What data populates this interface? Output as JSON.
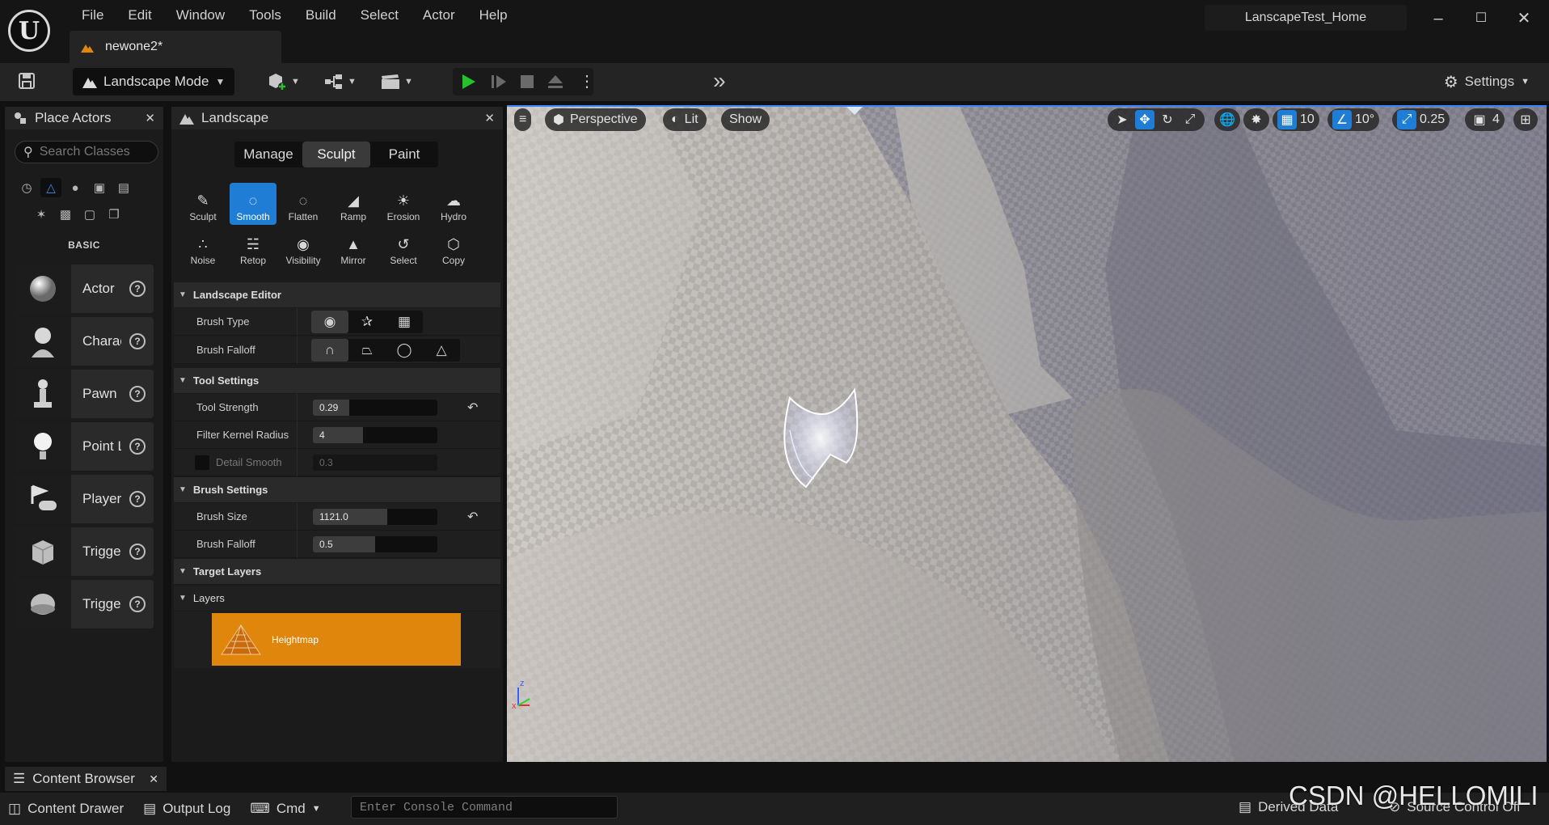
{
  "menu": [
    "File",
    "Edit",
    "Window",
    "Tools",
    "Build",
    "Select",
    "Actor",
    "Help"
  ],
  "document_tab": "newone2*",
  "project_name": "LanscapeTest_Home",
  "toolbar": {
    "mode": "Landscape Mode",
    "settings": "Settings"
  },
  "place_actors": {
    "title": "Place Actors",
    "search_placeholder": "Search Classes",
    "category": "BASIC",
    "items": [
      {
        "label": "Actor",
        "icon": "sphere-icon"
      },
      {
        "label": "Charac",
        "icon": "character-icon"
      },
      {
        "label": "Pawn",
        "icon": "pawn-icon"
      },
      {
        "label": "Point L",
        "icon": "light-bulb-icon"
      },
      {
        "label": "Player",
        "icon": "player-start-icon"
      },
      {
        "label": "Trigge",
        "icon": "trigger-box-icon"
      },
      {
        "label": "Trigge",
        "icon": "trigger-sphere-icon"
      }
    ]
  },
  "landscape": {
    "title": "Landscape",
    "mode_tabs": [
      "Manage",
      "Sculpt",
      "Paint"
    ],
    "active_mode": "Sculpt",
    "tools": [
      "Sculpt",
      "Smooth",
      "Flatten",
      "Ramp",
      "Erosion",
      "Hydro",
      "Noise",
      "Retop",
      "Visibility",
      "Mirror",
      "Select",
      "Copy"
    ],
    "active_tool": "Smooth",
    "sections": {
      "editor": "Landscape Editor",
      "tool_settings": "Tool Settings",
      "brush_settings": "Brush Settings",
      "target_layers": "Target Layers",
      "layers": "Layers"
    },
    "props": {
      "brush_type": "Brush Type",
      "brush_falloff_shape": "Brush Falloff",
      "tool_strength": {
        "label": "Tool Strength",
        "value": "0.29",
        "fill": 0.29
      },
      "filter_kernel": {
        "label": "Filter Kernel Radius",
        "value": "4",
        "fill": 0.4
      },
      "detail_smooth": {
        "label": "Detail Smooth",
        "value": "0.3"
      },
      "brush_size": {
        "label": "Brush Size",
        "value": "1121.0",
        "fill": 0.6
      },
      "brush_falloff": {
        "label": "Brush Falloff",
        "value": "0.5",
        "fill": 0.5
      }
    },
    "layer": "Heightmap"
  },
  "viewport": {
    "menu": "≡",
    "perspective": "Perspective",
    "lit": "Lit",
    "show": "Show",
    "grid_snap": "10",
    "rot_snap": "10°",
    "scale_snap": "0.25",
    "camera_speed": "4"
  },
  "bottom": {
    "content_browser": "Content Browser",
    "content_drawer": "Content Drawer",
    "output_log": "Output Log",
    "cmd": "Cmd",
    "console_placeholder": "Enter Console Command",
    "derived_data": "Derived Data",
    "source_control": "Source Control Off"
  },
  "watermark": "CSDN @HELLOMILI",
  "colors": {
    "accent": "#1f7dd6",
    "layer": "#e0860d",
    "play": "#27c12b"
  }
}
